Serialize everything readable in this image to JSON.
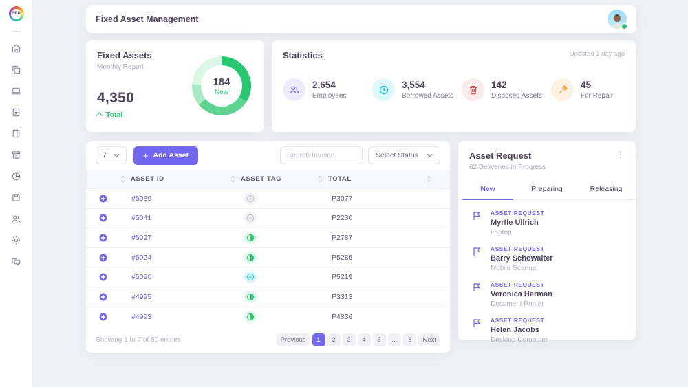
{
  "app": {
    "title": "Fixed Asset Management",
    "logo_text": "ERP"
  },
  "sidebar": {
    "items": [
      "home",
      "copy",
      "laptop",
      "notes",
      "book",
      "archive",
      "pie-chart",
      "save",
      "users",
      "settings",
      "chat"
    ]
  },
  "colors": {
    "accent": "#7367f0",
    "green": "#28c76f",
    "cyan": "#00cfe8",
    "red": "#ea5455",
    "orange": "#ff9f43"
  },
  "fixed_assets": {
    "title": "Fixed Assets",
    "subtitle": "Monthly Report",
    "total_value": "4,350",
    "total_label": "Total",
    "chart_data": {
      "type": "donut",
      "title": "Fixed Assets Monthly Report",
      "center_value": "184",
      "center_label": "New",
      "total": 4350,
      "new_count": 184,
      "segments": [
        {
          "name": "segment-1",
          "pct": 34,
          "color": "#28c76f"
        },
        {
          "name": "segment-2",
          "pct": 30,
          "color": "#5fd492"
        },
        {
          "name": "segment-3",
          "pct": 12,
          "color": "#a8e8c4"
        },
        {
          "name": "segment-4",
          "pct": 24,
          "color": "#dcf6e8"
        }
      ]
    }
  },
  "statistics": {
    "title": "Statistics",
    "updated": "Updated 1 day ago",
    "items": [
      {
        "value": "2,654",
        "label": "Employees",
        "icon": "users-icon",
        "color": "#7367f0"
      },
      {
        "value": "3,554",
        "label": "Borrowed Assets",
        "icon": "clock-icon",
        "color": "#00cfe8"
      },
      {
        "value": "142",
        "label": "Disposed Assets",
        "icon": "trash-icon",
        "color": "#ea5455"
      },
      {
        "value": "45",
        "label": "For Repair",
        "icon": "hammer-icon",
        "color": "#ff9f43"
      }
    ]
  },
  "asset_table": {
    "per_page": "7",
    "add_asset_label": "Add Asset",
    "search_placeholder": "Search Invoice",
    "status_placeholder": "Select Status",
    "columns": {
      "id": "ASSET ID",
      "tag": "ASSET TAG",
      "total": "TOTAL"
    },
    "rows": [
      {
        "id": "#5089",
        "tag_icon": "check-circle-icon",
        "total": "P3077"
      },
      {
        "id": "#5041",
        "tag_icon": "check-circle-icon",
        "total": "P2230"
      },
      {
        "id": "#5027",
        "tag_icon": "half-circle-green-icon",
        "total": "P2787"
      },
      {
        "id": "#5024",
        "tag_icon": "half-circle-green-icon",
        "total": "P5285"
      },
      {
        "id": "#5020",
        "tag_icon": "arrow-down-circle-cyan-icon",
        "total": "P5219"
      },
      {
        "id": "#4995",
        "tag_icon": "half-circle-green-icon",
        "total": "P3313"
      },
      {
        "id": "#4993",
        "tag_icon": "half-circle-green-icon",
        "total": "P4836"
      }
    ],
    "footer_text": "Showing 1 to 7 of 50 entries",
    "pagination": [
      "Previous",
      "1",
      "2",
      "3",
      "4",
      "5",
      "...",
      "8",
      "Next"
    ],
    "active_page": "1"
  },
  "asset_request": {
    "title": "Asset Request",
    "subtitle": "62 Deliveries in Progress",
    "tabs": [
      "New",
      "Preparing",
      "Releasing"
    ],
    "active_tab": "New",
    "items": [
      {
        "tag": "ASSET REQUEST",
        "name": "Myrtle Ullrich",
        "device": "Laptop"
      },
      {
        "tag": "ASSET REQUEST",
        "name": "Barry Schowalter",
        "device": "Mobile Scanner"
      },
      {
        "tag": "ASSET REQUEST",
        "name": "Veronica Herman",
        "device": "Document Printer"
      },
      {
        "tag": "ASSET REQUEST",
        "name": "Helen Jacobs",
        "device": "Desktop Computer"
      }
    ]
  }
}
